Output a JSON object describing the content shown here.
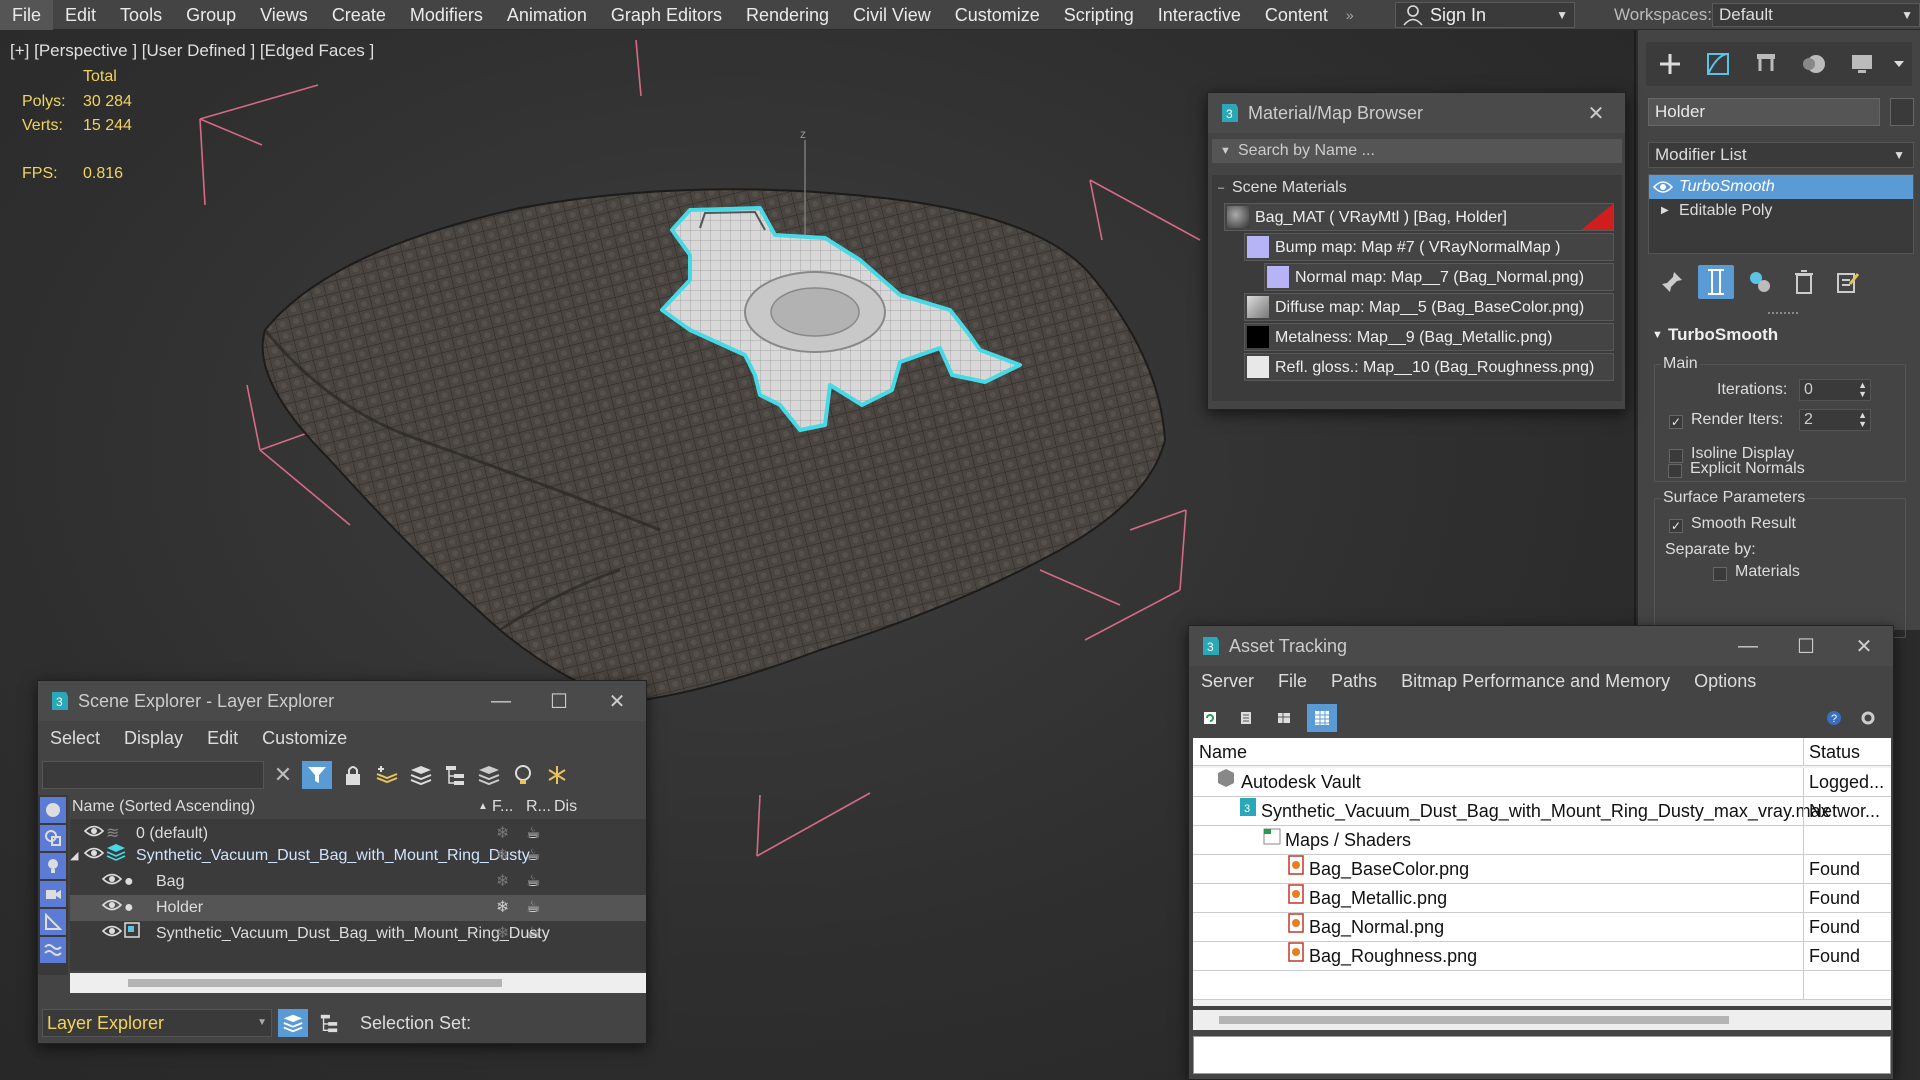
{
  "menubar": {
    "items": [
      "File",
      "Edit",
      "Tools",
      "Group",
      "Views",
      "Create",
      "Modifiers",
      "Animation",
      "Graph Editors",
      "Rendering",
      "Civil View",
      "Customize",
      "Scripting",
      "Interactive",
      "Content"
    ],
    "more": "»",
    "signin": "Sign In",
    "workspaces_label": "Workspaces:",
    "workspace": "Default"
  },
  "viewport": {
    "label": "[+] [Perspective ] [User Defined ] [Edged Faces ]",
    "total_label": "Total",
    "polys_label": "Polys:",
    "polys": "30 284",
    "verts_label": "Verts:",
    "verts": "15 244",
    "fps_label": "FPS:",
    "fps": "0.816",
    "axis_z": "z"
  },
  "command_panel": {
    "object_name": "Holder",
    "modifier_list": "Modifier List",
    "stack": [
      "TurboSmooth",
      "Editable Poly"
    ],
    "rollout_title": "TurboSmooth",
    "main_group": "Main",
    "iterations_label": "Iterations:",
    "iterations": "0",
    "render_iters_label": "Render Iters:",
    "render_iters": "2",
    "isoline": "Isoline Display",
    "explicit_normals": "Explicit Normals",
    "surface_group": "Surface Parameters",
    "smooth_result": "Smooth Result",
    "separate_by": "Separate by:",
    "materials": "Materials"
  },
  "material_browser": {
    "title": "Material/Map Browser",
    "search_placeholder": "Search by Name ...",
    "section": "Scene Materials",
    "rows": [
      {
        "text": "Bag_MAT  ( VRayMtl )  [Bag, Holder]",
        "swatch": "#5a5a5a"
      },
      {
        "text": "Bump map: Map #7  ( VRayNormalMap )",
        "swatch": "#b7b3f7"
      },
      {
        "text": "Normal map: Map__7 (Bag_Normal.png)",
        "swatch": "#b7b3f7"
      },
      {
        "text": "Diffuse map: Map__5 (Bag_BaseColor.png)",
        "swatch": "#8a8a8a"
      },
      {
        "text": "Metalness: Map__9 (Bag_Metallic.png)",
        "swatch": "#000000"
      },
      {
        "text": "Refl. gloss.: Map__10 (Bag_Roughness.png)",
        "swatch": "#e8e8e8"
      }
    ]
  },
  "scene_explorer": {
    "title": "Scene Explorer - Layer Explorer",
    "menu": [
      "Select",
      "Display",
      "Edit",
      "Customize"
    ],
    "col_name": "Name (Sorted Ascending)",
    "col_f": "F...",
    "col_r": "R...",
    "col_dis": "Dis",
    "rows": [
      {
        "name": "0 (default)",
        "indent": 0
      },
      {
        "name": "Synthetic_Vacuum_Dust_Bag_with_Mount_Ring_Dusty",
        "indent": 0
      },
      {
        "name": "Bag",
        "indent": 1
      },
      {
        "name": "Holder",
        "indent": 1
      },
      {
        "name": "Synthetic_Vacuum_Dust_Bag_with_Mount_Ring_Dusty",
        "indent": 1
      }
    ],
    "layer_explorer": "Layer Explorer",
    "selection_set": "Selection Set:"
  },
  "asset_tracking": {
    "title": "Asset Tracking",
    "menu": [
      "Server",
      "File",
      "Paths",
      "Bitmap Performance and Memory",
      "Options"
    ],
    "col_name": "Name",
    "col_status": "Status",
    "rows": [
      {
        "name": "Autodesk Vault",
        "status": "Logged...",
        "indent": 1
      },
      {
        "name": "Synthetic_Vacuum_Dust_Bag_with_Mount_Ring_Dusty_max_vray.max",
        "status": "Networ...",
        "indent": 2
      },
      {
        "name": "Maps / Shaders",
        "status": "",
        "indent": 3
      },
      {
        "name": "Bag_BaseColor.png",
        "status": "Found",
        "indent": 4
      },
      {
        "name": "Bag_Metallic.png",
        "status": "Found",
        "indent": 4
      },
      {
        "name": "Bag_Normal.png",
        "status": "Found",
        "indent": 4
      },
      {
        "name": "Bag_Roughness.png",
        "status": "Found",
        "indent": 4
      }
    ]
  }
}
